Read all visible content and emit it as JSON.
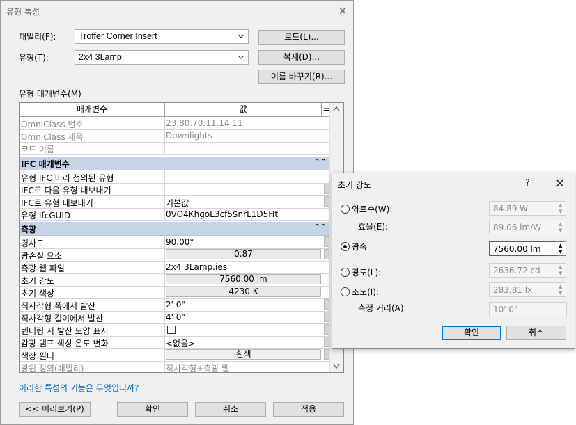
{
  "type_properties": {
    "title": "유형 특성",
    "family_label": "패밀리(F):",
    "family_value": "Troffer Corner Insert",
    "type_label": "유형(T):",
    "type_value": "2x4 3Lamp",
    "load_button": "로드(L)...",
    "duplicate_button": "복제(D)...",
    "rename_button": "이름 바꾸기(R)...",
    "params_label": "유형 매개변수(M)",
    "header_param": "매개변수",
    "header_value": "값",
    "header_eq": "=",
    "rows_top": [
      {
        "p": "OmniClass 번호",
        "v": "23.80.70.11.14.11"
      },
      {
        "p": "OmniClass 제목",
        "v": "Downlights"
      },
      {
        "p": "코드 이름",
        "v": ""
      }
    ],
    "group_ifc": "IFC 매개변수",
    "rows_ifc": [
      {
        "p": "유형 IFC 미리 정의된 유형",
        "v": ""
      },
      {
        "p": "IFC로 다음 유형 내보내기",
        "v": ""
      },
      {
        "p": "IFC로 유형 내보내기",
        "v": "기본값"
      },
      {
        "p": "유형 IfcGUID",
        "v": "0VO4KhgoL3cf5$nrL1D5Ht"
      }
    ],
    "group_photometric": "측광",
    "rows_photo": [
      {
        "p": "경사도",
        "v": "90.00°"
      },
      {
        "p": "광손실 요소",
        "v": "0.87"
      },
      {
        "p": "측광 웹 파일",
        "v": "2x4 3Lamp.ies"
      },
      {
        "p": "초기 강도",
        "v": "7560.00 lm"
      },
      {
        "p": "초기 색상",
        "v": "4230 K"
      },
      {
        "p": "직사각형 폭에서 발산",
        "v": "2'  0\""
      },
      {
        "p": "직사각형 길이에서 발산",
        "v": "4'  0\""
      },
      {
        "p": "렌더링 시 발산 모양 표시",
        "v": ""
      },
      {
        "p": "감광 램프 색상 온도 변화",
        "v": "<없음>"
      },
      {
        "p": "색상 필터",
        "v": "흰색"
      },
      {
        "p": "광원 정의(패밀리)",
        "v": "직사각형+측광 웹"
      }
    ],
    "help_link": "이러한 특성의 기능은 무엇입니까?",
    "preview_button": "<< 미리보기(P)",
    "ok_button": "확인",
    "cancel_button": "취소",
    "apply_button": "적용"
  },
  "initial_intensity": {
    "title": "초기 강도",
    "help": "?",
    "wattage_label": "와트수(W):",
    "wattage_value": "84.89 W",
    "efficacy_label": "효율(E):",
    "efficacy_value": "89.06 lm/W",
    "flux_label": "광속",
    "flux_value": "7560.00 lm",
    "intensity_label": "광도(L):",
    "intensity_value": "2636.72 cd",
    "illuminance_label": "조도(I):",
    "illuminance_value": "283.81 lx",
    "distance_label": "측정 거리(A):",
    "distance_value": "10'  0\"",
    "ok_button": "확인",
    "cancel_button": "취소"
  },
  "colors": {
    "group_band": "#c5d4e6",
    "focus": "#0078d7",
    "link": "#0066cc"
  }
}
